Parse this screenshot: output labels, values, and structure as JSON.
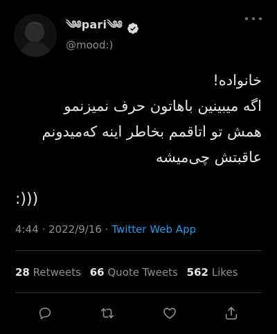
{
  "tweet": {
    "display_name": "༄༅pari༄༅",
    "handle": "@mood:)",
    "lines": [
      "خانواده!",
      "اگه میبینین باهاتون حرف نمیزنمو",
      "همش تو اتاقمم بخاطر اینه که‌میدونم",
      "عاقبتش چی‌میشه"
    ],
    "emote": ":)))",
    "time": "4:44",
    "date": "2022/9/16",
    "separator": "·",
    "source_app": "Twitter Web App"
  },
  "stats": {
    "retweets_count": "28",
    "retweets_label": "Retweets",
    "quote_count": "66",
    "quote_label": "Quote Tweets",
    "likes_count": "562",
    "likes_label": "Likes"
  },
  "icons": {
    "verified": "verified-badge-icon",
    "more": "more-options-icon",
    "reply": "reply-icon",
    "retweet": "retweet-icon",
    "like": "heart-icon",
    "share": "share-icon"
  },
  "colors": {
    "background": "#000000",
    "text": "#e6e6e6",
    "muted": "#8b8f94",
    "accent": "#1d9bf0",
    "divider": "#2f3336"
  }
}
